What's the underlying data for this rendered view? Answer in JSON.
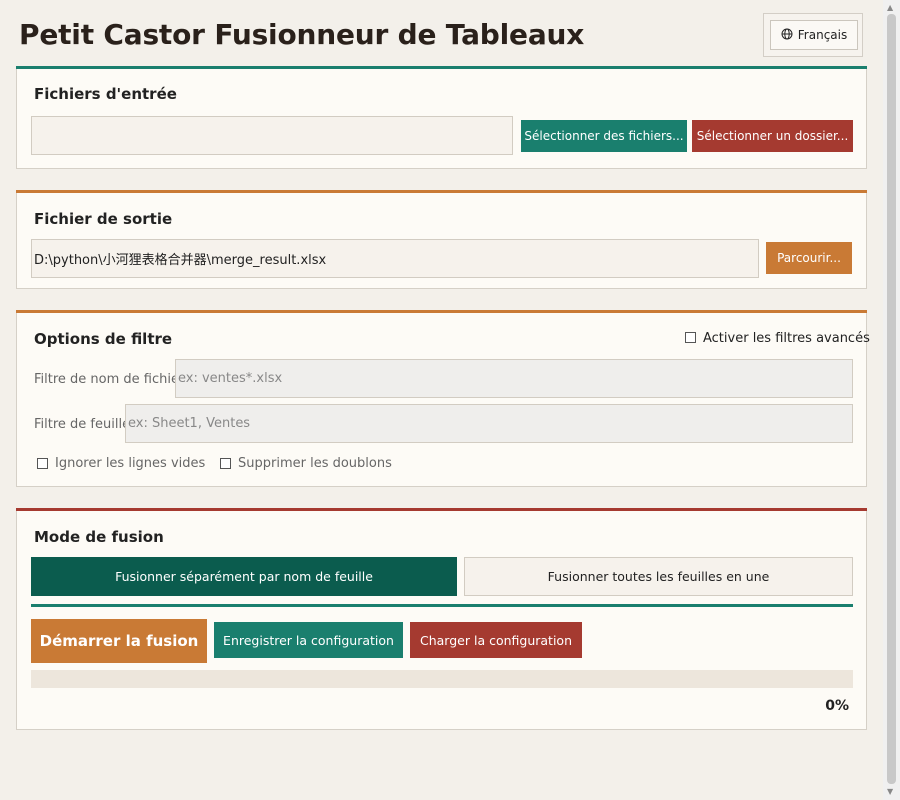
{
  "app": {
    "title": "Petit Castor Fusionneur de Tableaux"
  },
  "language": {
    "label": "Français",
    "icon": "globe-icon"
  },
  "input_section": {
    "title": "Fichiers d'entrée",
    "files_value": "",
    "select_files_label": "Sélectionner des fichiers...",
    "select_folder_label": "Sélectionner un dossier..."
  },
  "output_section": {
    "title": "Fichier de sortie",
    "path_value": "D:\\python\\小河狸表格合并器\\merge_result.xlsx",
    "browse_label": "Parcourir..."
  },
  "filter_section": {
    "title": "Options de filtre",
    "advanced_label": "Activer les filtres avancés",
    "advanced_checked": false,
    "filename_label": "Filtre de nom de fichier:",
    "filename_placeholder": "ex: ventes*.xlsx",
    "sheet_label": "Filtre de feuille:",
    "sheet_placeholder": "ex: Sheet1, Ventes",
    "ignore_empty_label": "Ignorer les lignes vides",
    "ignore_empty_checked": false,
    "remove_dup_label": "Supprimer les doublons",
    "remove_dup_checked": false
  },
  "merge_section": {
    "title": "Mode de fusion",
    "mode_by_sheet_label": "Fusionner séparément par nom de feuille",
    "mode_all_label": "Fusionner toutes les feuilles en une",
    "selected_mode": "by_sheet"
  },
  "actions": {
    "start_label": "Démarrer la fusion",
    "save_config_label": "Enregistrer la configuration",
    "load_config_label": "Charger la configuration"
  },
  "progress": {
    "value": 0,
    "text": "0%"
  },
  "colors": {
    "teal": "#1a7f6e",
    "dark_green": "#0b5c4e",
    "red": "#a53a30",
    "orange": "#c97a35"
  }
}
